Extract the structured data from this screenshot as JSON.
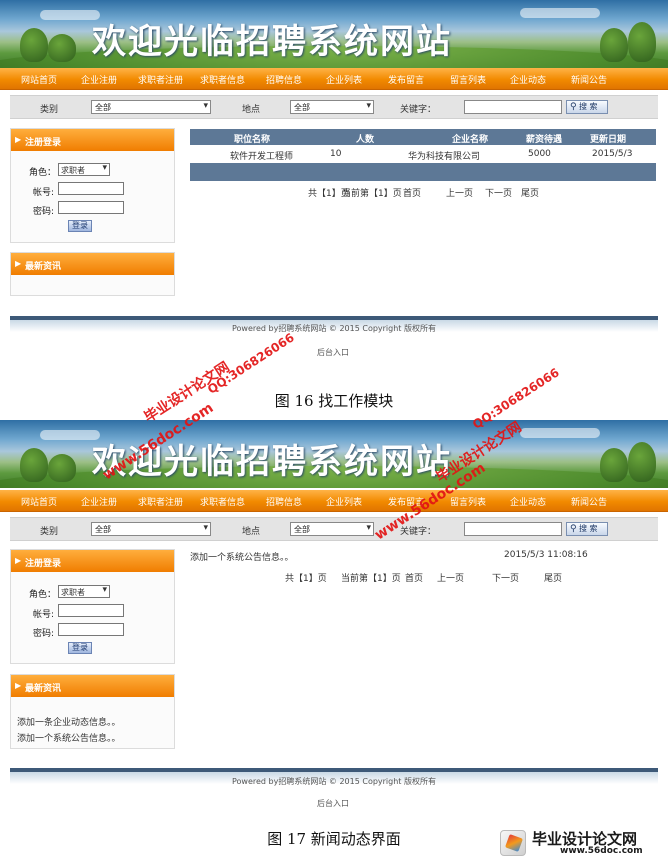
{
  "site": {
    "banner_title": "欢迎光临招聘系统网站",
    "nav": [
      "网站首页",
      "企业注册",
      "求职者注册",
      "求职者信息",
      "招聘信息",
      "企业列表",
      "发布留言",
      "留言列表",
      "企业动态",
      "新闻公告"
    ]
  },
  "search": {
    "category_label": "类别",
    "category_value": "全部",
    "location_label": "地点",
    "location_value": "全部",
    "keyword_label": "关键字：",
    "button_label": "搜 索"
  },
  "login": {
    "header": "注册登录",
    "role_label": "角色：",
    "role_value": "求职者",
    "account_label": "帐号:",
    "password_label": "密码:",
    "submit_label": "登录"
  },
  "news_panel": {
    "header": "最新资讯"
  },
  "fig16": {
    "table": {
      "columns": [
        "职位名称",
        "人数",
        "企业名称",
        "薪资待遇",
        "更新日期"
      ],
      "rows": [
        [
          "软件开发工程师",
          "10",
          "华为科技有限公司",
          "5000",
          "2015/5/3"
        ]
      ]
    },
    "pager": [
      "共【1】页",
      "当前第【1】页",
      "首页",
      "上一页",
      "下一页",
      "尾页"
    ],
    "footer": "Powered by招聘系统网站 © 2015 Copyright 版权所有",
    "admin": "后台入口",
    "caption": "图 16 找工作模块"
  },
  "fig17": {
    "notice_text": "添加一个系统公告信息。。",
    "notice_time": "2015/5/3 11:08:16",
    "pager": [
      "共【1】页",
      "当前第【1】页",
      "首页",
      "上一页",
      "下一页",
      "尾页"
    ],
    "news_items": [
      "添加一条企业动态信息。。",
      "添加一个系统公告信息。。"
    ],
    "footer": "Powered by招聘系统网站 © 2015 Copyright 版权所有",
    "admin": "后台入口",
    "caption": "图 17 新闻动态界面"
  },
  "watermarks": {
    "site_name": "毕业设计论文网",
    "url": "www.56doc.com",
    "qq": "QQ:306826066",
    "logo_name": "毕业设计论文网",
    "logo_url": "www.56doc.com"
  },
  "colors": {
    "nav_orange": "#f28a00",
    "table_header": "#5d7896",
    "watermark_red": "#e21414"
  }
}
